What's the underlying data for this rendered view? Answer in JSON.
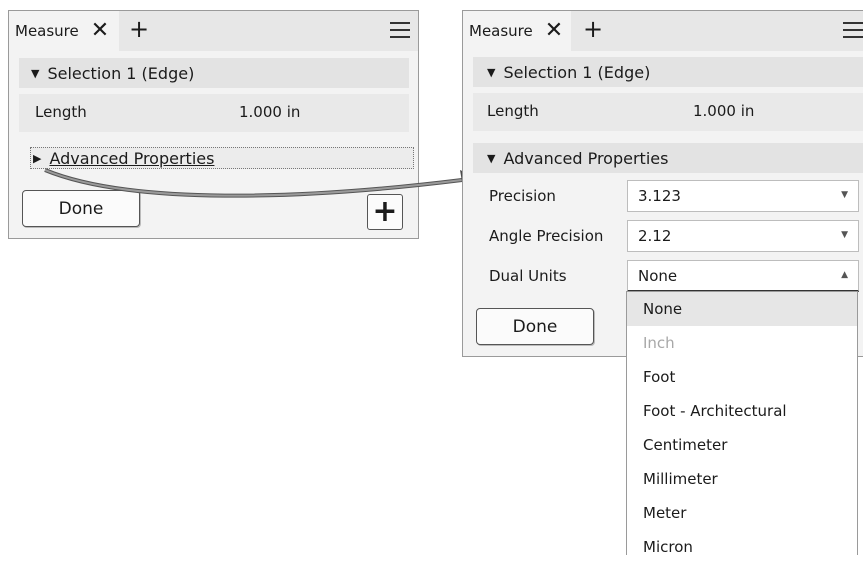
{
  "left_panel": {
    "tab_label": "Measure",
    "close_glyph": "✕",
    "add_tab_glyph": "+",
    "menu_icon": "hamburger-menu-icon",
    "selection_header": "Selection 1 (Edge)",
    "length_label": "Length",
    "length_value": "1.000 in",
    "advanced_header": "Advanced Properties",
    "done_label": "Done",
    "add_button_glyph": "+"
  },
  "right_panel": {
    "tab_label": "Measure",
    "close_glyph": "✕",
    "add_tab_glyph": "+",
    "menu_icon": "hamburger-menu-icon",
    "selection_header": "Selection 1 (Edge)",
    "length_label": "Length",
    "length_value": "1.000 in",
    "advanced_header": "Advanced Properties",
    "properties": [
      {
        "label": "Precision",
        "value": "3.123"
      },
      {
        "label": "Angle Precision",
        "value": "2.12"
      },
      {
        "label": "Dual Units",
        "value": "None"
      }
    ],
    "done_label": "Done"
  },
  "dual_units_dropdown": {
    "options": [
      {
        "label": "None",
        "state": "selected"
      },
      {
        "label": "Inch",
        "state": "disabled"
      },
      {
        "label": "Foot",
        "state": "normal"
      },
      {
        "label": "Foot - Architectural",
        "state": "normal"
      },
      {
        "label": "Centimeter",
        "state": "normal"
      },
      {
        "label": "Millimeter",
        "state": "normal"
      },
      {
        "label": "Meter",
        "state": "normal"
      },
      {
        "label": "Micron",
        "state": "normal"
      }
    ]
  },
  "arrow_icon": "curved-arrow-icon"
}
